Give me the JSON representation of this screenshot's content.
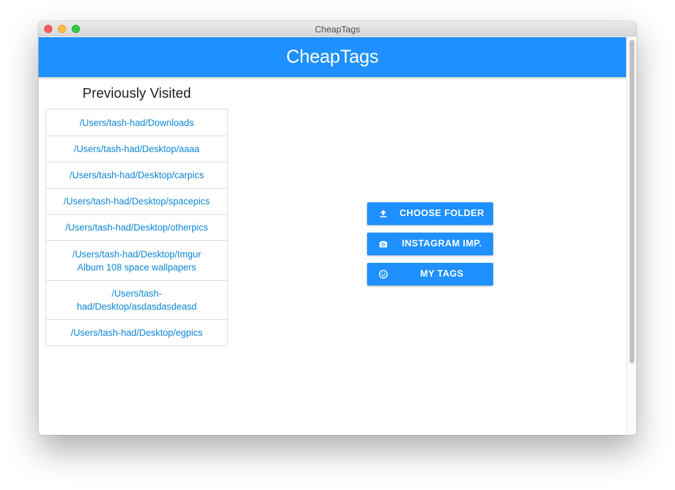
{
  "window": {
    "title": "CheapTags"
  },
  "header": {
    "title": "CheapTags",
    "color": "#1e90ff"
  },
  "visited": {
    "heading": "Previously Visited",
    "items": [
      {
        "label": "/Users/tash-had/Downloads"
      },
      {
        "label": "/Users/tash-had/Desktop/aaaa"
      },
      {
        "label": "/Users/tash-had/Desktop/carpics"
      },
      {
        "label": "/Users/tash-had/Desktop/spacepics"
      },
      {
        "label": "/Users/tash-had/Desktop/otherpics"
      },
      {
        "label": "/Users/tash-had/Desktop/Imgur Album 108 space wallpapers"
      },
      {
        "label": "/Users/tash-had/Desktop/asdasdasdeasd"
      },
      {
        "label": "/Users/tash-had/Desktop/egpics"
      }
    ],
    "link_color": "#0b85d6"
  },
  "actions": {
    "choose_folder": {
      "label": "CHOOSE FOLDER",
      "icon": "upload-icon"
    },
    "instagram": {
      "label": "INSTAGRAM IMP.",
      "icon": "camera-icon"
    },
    "my_tags": {
      "label": "MY TAGS",
      "icon": "smiley-icon"
    }
  }
}
